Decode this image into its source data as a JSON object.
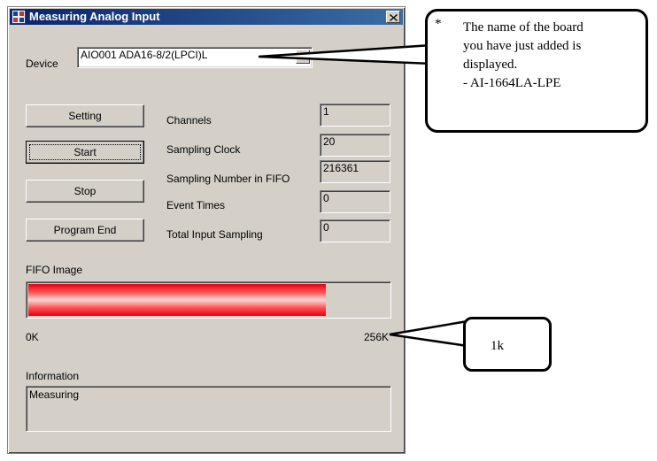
{
  "window": {
    "title": "Measuring Analog Input"
  },
  "device": {
    "label": "Device",
    "value": "AIO001 ADA16-8/2(LPCI)L"
  },
  "buttons": {
    "setting": "Setting",
    "start": "Start",
    "stop": "Stop",
    "program_end": "Program End"
  },
  "fields": [
    {
      "label": "Channels",
      "value": "1"
    },
    {
      "label": "Sampling Clock",
      "value": "20"
    },
    {
      "label": "Sampling Number in FIFO",
      "value": "216361"
    },
    {
      "label": "Event Times",
      "value": "0"
    },
    {
      "label": "Total Input Sampling",
      "value": "0"
    }
  ],
  "fifo": {
    "label": "FIFO Image",
    "min_label": "0K",
    "max_label": "256K",
    "fill_fraction": 0.825
  },
  "information": {
    "label": "Information",
    "text": "Measuring"
  },
  "callout_device": {
    "marker": "*",
    "lines": [
      "The name of the board",
      "you have just added is",
      "displayed.",
      "- AI-1664LA-LPE"
    ]
  },
  "callout_fifo": {
    "text": "1k"
  },
  "colors": {
    "titlebar": "#0a246a",
    "face": "#d4d0c8",
    "fifo_fill": "#e70012"
  }
}
